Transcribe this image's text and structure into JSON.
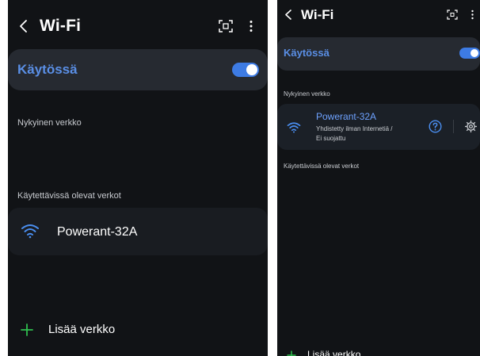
{
  "colors": {
    "background": "#111316",
    "card": "#262a31",
    "accent": "#3d7be4",
    "accent_text": "#5a8fe6",
    "connected_name": "#6ea2ff",
    "add_icon": "#2fbf4f"
  },
  "screens": [
    {
      "header": {
        "title": "Wi-Fi",
        "icons": [
          "back-icon",
          "qr-scan-icon",
          "more-vert-icon"
        ]
      },
      "wifi_enabled": {
        "label": "Käytössä",
        "on": true
      },
      "current_network": {
        "header": "Nykyinen verkko"
      },
      "available_networks": {
        "header": "Käytettävissä olevat verkot",
        "items": [
          {
            "name": "Powerant-32A",
            "icon": "wifi-icon"
          }
        ]
      },
      "add_network": {
        "label": "Lisää verkko",
        "icon": "plus-icon"
      }
    },
    {
      "header": {
        "title": "Wi-Fi",
        "icons": [
          "back-icon",
          "qr-scan-icon",
          "more-vert-icon"
        ]
      },
      "wifi_enabled": {
        "label": "Käytössä",
        "on": true
      },
      "current_network": {
        "header": "Nykyinen verkko",
        "item": {
          "name": "Powerant-32A",
          "status": "Yhdistetty ilman Internetiä /",
          "security": "Ei suojattu",
          "icons": [
            "wifi-icon",
            "help-icon",
            "settings-icon"
          ]
        }
      },
      "available_networks": {
        "header": "Käytettävissä olevat verkot"
      },
      "add_network": {
        "label": "Lisää verkko",
        "icon": "plus-icon"
      }
    }
  ]
}
